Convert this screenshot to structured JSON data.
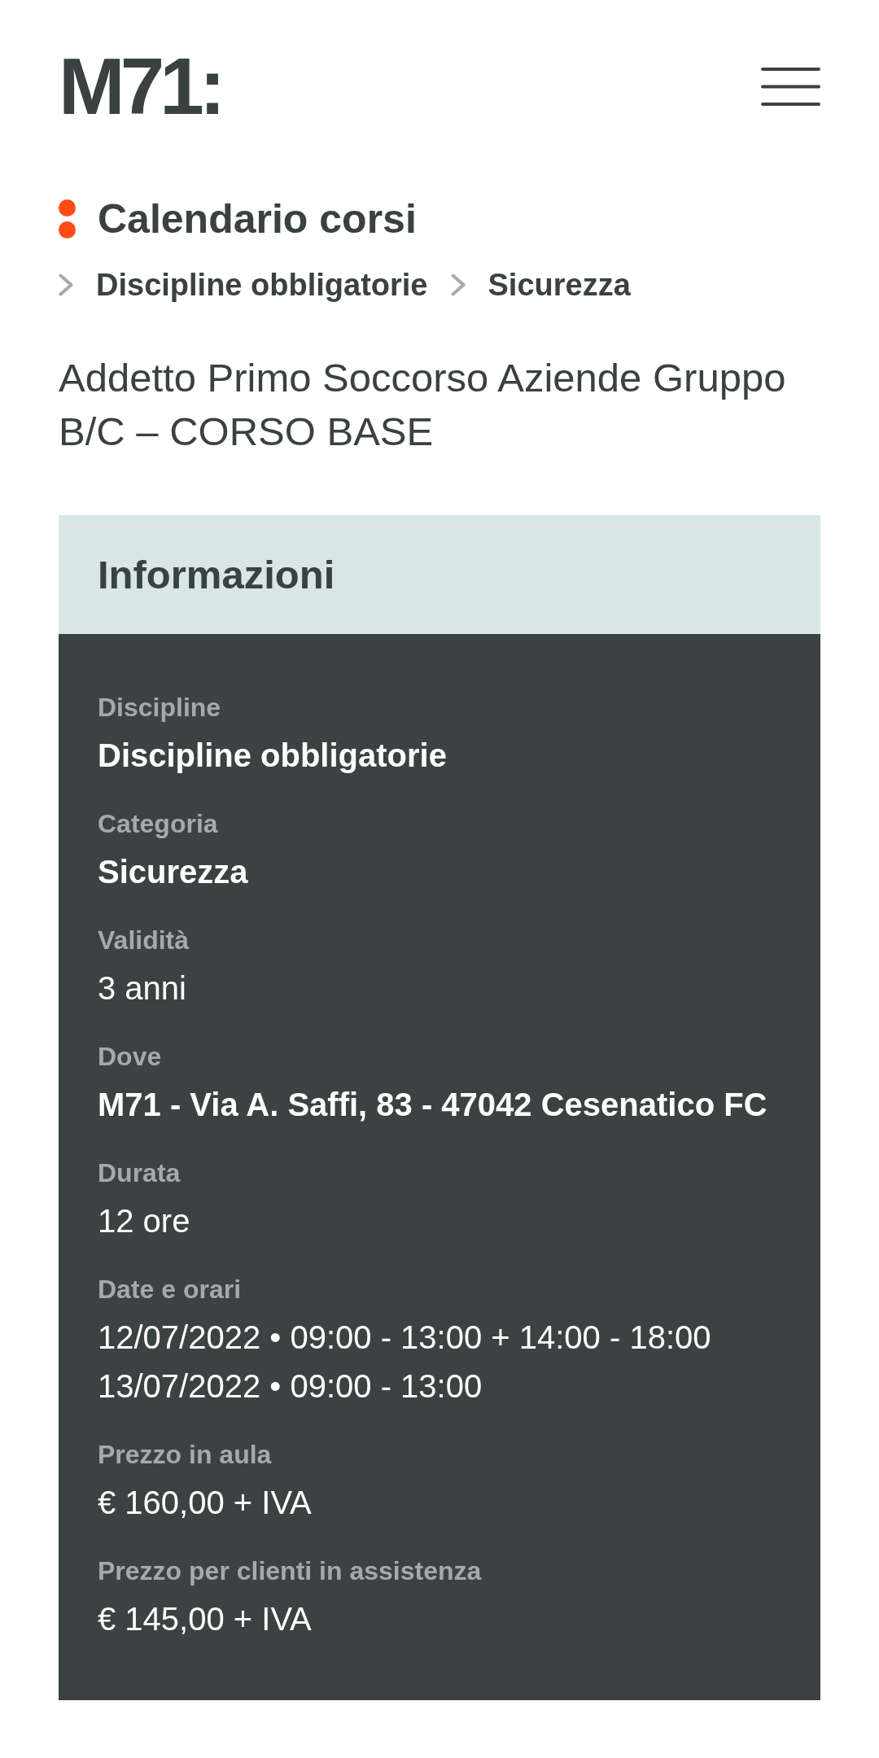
{
  "header": {
    "logo": "M71:"
  },
  "section": {
    "title": "Calendario corsi"
  },
  "breadcrumb": [
    {
      "label": "Discipline obbligatorie"
    },
    {
      "label": "Sicurezza"
    }
  ],
  "course": {
    "title": "Addetto Primo Soccorso Aziende Gruppo B/C – CORSO BASE"
  },
  "info": {
    "title": "Informazioni",
    "fields": [
      {
        "label": "Discipline",
        "kind": "strong",
        "lines": [
          "Discipline obbligatorie"
        ]
      },
      {
        "label": "Categoria",
        "kind": "strong",
        "lines": [
          "Sicurezza"
        ]
      },
      {
        "label": "Validità",
        "kind": "plain",
        "lines": [
          "3 anni"
        ]
      },
      {
        "label": "Dove",
        "kind": "strong",
        "lines": [
          "M71 - Via A. Saffi, 83 - 47042 Cesenatico FC"
        ]
      },
      {
        "label": "Durata",
        "kind": "plain",
        "lines": [
          "12 ore"
        ]
      },
      {
        "label": "Date e orari",
        "kind": "plain",
        "lines": [
          "12/07/2022 • 09:00 - 13:00 + 14:00 - 18:00",
          "13/07/2022 • 09:00 - 13:00"
        ]
      },
      {
        "label": "Prezzo in aula",
        "kind": "plain",
        "lines": [
          "€ 160,00 + IVA"
        ]
      },
      {
        "label": "Prezzo per clienti in assistenza",
        "kind": "plain",
        "lines": [
          "€ 145,00 + IVA"
        ]
      }
    ]
  }
}
